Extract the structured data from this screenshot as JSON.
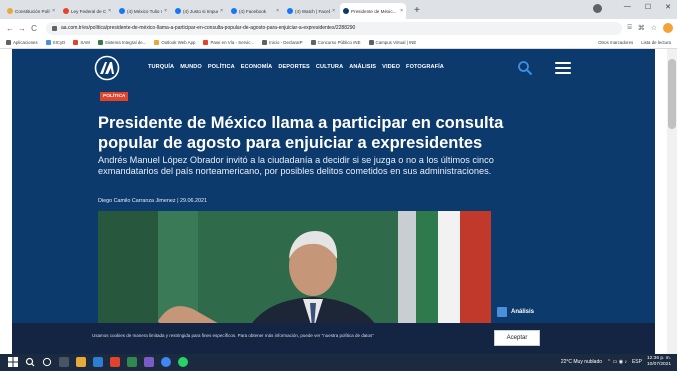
{
  "browser": {
    "tabs": [
      {
        "label": "Constitución Política...",
        "fav_color": "#e8a93b",
        "active": false
      },
      {
        "label": "Ley Federal de Consu...",
        "fav_color": "#e4432b",
        "active": false
      },
      {
        "label": "(4) México Tulio Serv...",
        "fav_color": "#1877f2",
        "active": false
      },
      {
        "label": "(4) Justo si Impuesto...",
        "fav_color": "#1877f2",
        "active": false
      },
      {
        "label": "(4) Facebook",
        "fav_color": "#1877f2",
        "active": false
      },
      {
        "label": "(4) Watch | Facebook",
        "fav_color": "#1877f2",
        "active": false
      },
      {
        "label": "Presidente de Méxic...",
        "fav_color": "#0d3a6c",
        "active": true
      }
    ],
    "tab_close_glyph": "×",
    "new_tab_glyph": "+",
    "window_controls": [
      "—",
      "☐",
      "✕"
    ],
    "url": "aa.com.tr/es/política/presidente-de-méxico-llama-a-participar-en-consulta-popular-de-agosto-para-enjuiciar-a-expresidentes/2288290",
    "nav": {
      "back": "←",
      "forward": "→",
      "reload": "C"
    },
    "toolbar_icons": [
      "⌸",
      "⌘",
      "☆"
    ]
  },
  "bookmarks": {
    "items": [
      {
        "label": "Aplicaciones",
        "color": "#5f6368"
      },
      {
        "label": "SICyD",
        "color": "#4a8fd9"
      },
      {
        "label": "SAM",
        "color": "#e4432b"
      },
      {
        "label": "Sistema Integral de...",
        "color": "#3a7d44"
      },
      {
        "label": "Outlook Web App",
        "color": "#e8a93b"
      },
      {
        "label": "Pase en Vía - Servic...",
        "color": "#e4432b"
      },
      {
        "label": "Inicio - DeclaraIP",
        "color": "#5f6368"
      },
      {
        "label": "Concurso Público INE",
        "color": "#5f6368"
      },
      {
        "label": "Campus Virtual | INE",
        "color": "#5f6368"
      }
    ],
    "other": "Otros marcadores",
    "reading_list": "Lista de lectura"
  },
  "site": {
    "nav_items": [
      "TURQUÍA",
      "MUNDO",
      "POLÍTICA",
      "ECONOMÍA",
      "DEPORTES",
      "CULTURA",
      "ANÁLISIS",
      "VIDEO",
      "FOTOGRAFÍA"
    ],
    "section_badge": "POLÍTICA",
    "headline": "Presidente de México llama a participar en consulta popular de agosto para enjuiciar a expresidentes",
    "dek": "Andrés Manuel López Obrador invitó a la ciudadanía a decidir si se juzga o no a los últimos cinco exmandatarios del país norteamericano, por posibles delitos cometidos en sus administraciones.",
    "byline": "Diego Camilo Carranza Jimenez  |  29.06.2021",
    "related_label": "Análisis",
    "brand_color": "#0d3a6c",
    "badge_color": "#e4432b"
  },
  "cookie_banner": {
    "text": "Usamos cookies de manera limitada y restringida para fines específicos. Para obtener más información, puede ver \"nuestra política de datos\"",
    "accept_label": "Aceptar"
  },
  "taskbar": {
    "weather": "22°C  Muy nublado",
    "lang": "ESP",
    "time": "12:36 p. m.",
    "date": "10/07/2021"
  }
}
